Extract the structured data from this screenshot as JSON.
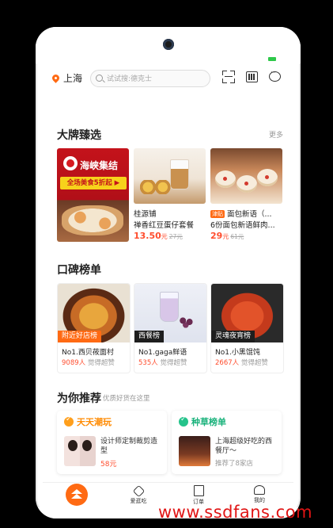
{
  "status": {
    "battery_color": "#2ec94a"
  },
  "topbar": {
    "city": "上海",
    "search_placeholder": "试试搜:德克士"
  },
  "brand": {
    "title": "大牌臻选",
    "more": "更多",
    "items": [
      {
        "image_title": "海峡集结",
        "promo": "全场美食5折起 ▶"
      },
      {
        "name": "桂源铺",
        "desc": "禅香红豆蛋仔套餐",
        "price": "13.50",
        "unit": "元",
        "old_price": "27元"
      },
      {
        "tag": "津贴",
        "name": "面包新语（...",
        "desc": "6份面包新语鲜肉...",
        "price": "29",
        "unit": "元",
        "old_price": "61元"
      }
    ]
  },
  "ranking": {
    "title": "口碑榜单",
    "items": [
      {
        "label": "附近好店榜",
        "name": "No1.西贝莜面村",
        "count": "9089人",
        "sub": "觉得超赞"
      },
      {
        "label": "西餐榜",
        "name": "No1.gaga鲜语",
        "count": "535人",
        "sub": "觉得超赞"
      },
      {
        "label": "灵魂夜宵榜",
        "name": "No1.小黑馄饨",
        "count": "2667人",
        "sub": "觉得超赞"
      }
    ]
  },
  "recommend": {
    "title": "为你推荐",
    "subtitle": "优质好货在这里",
    "cards": [
      {
        "heading": "天天潮玩",
        "text": "设计师定制裁剪造型",
        "meta": "58元"
      },
      {
        "heading": "种草榜单",
        "text": "上海超级好吃的西餐厅～",
        "meta": "推荐了8家店"
      }
    ]
  },
  "tabbar": {
    "items": [
      {
        "label": "爱逛吃"
      },
      {
        "label": "订单"
      },
      {
        "label": "我的"
      }
    ]
  },
  "watermark": "www.ssdfans.com"
}
